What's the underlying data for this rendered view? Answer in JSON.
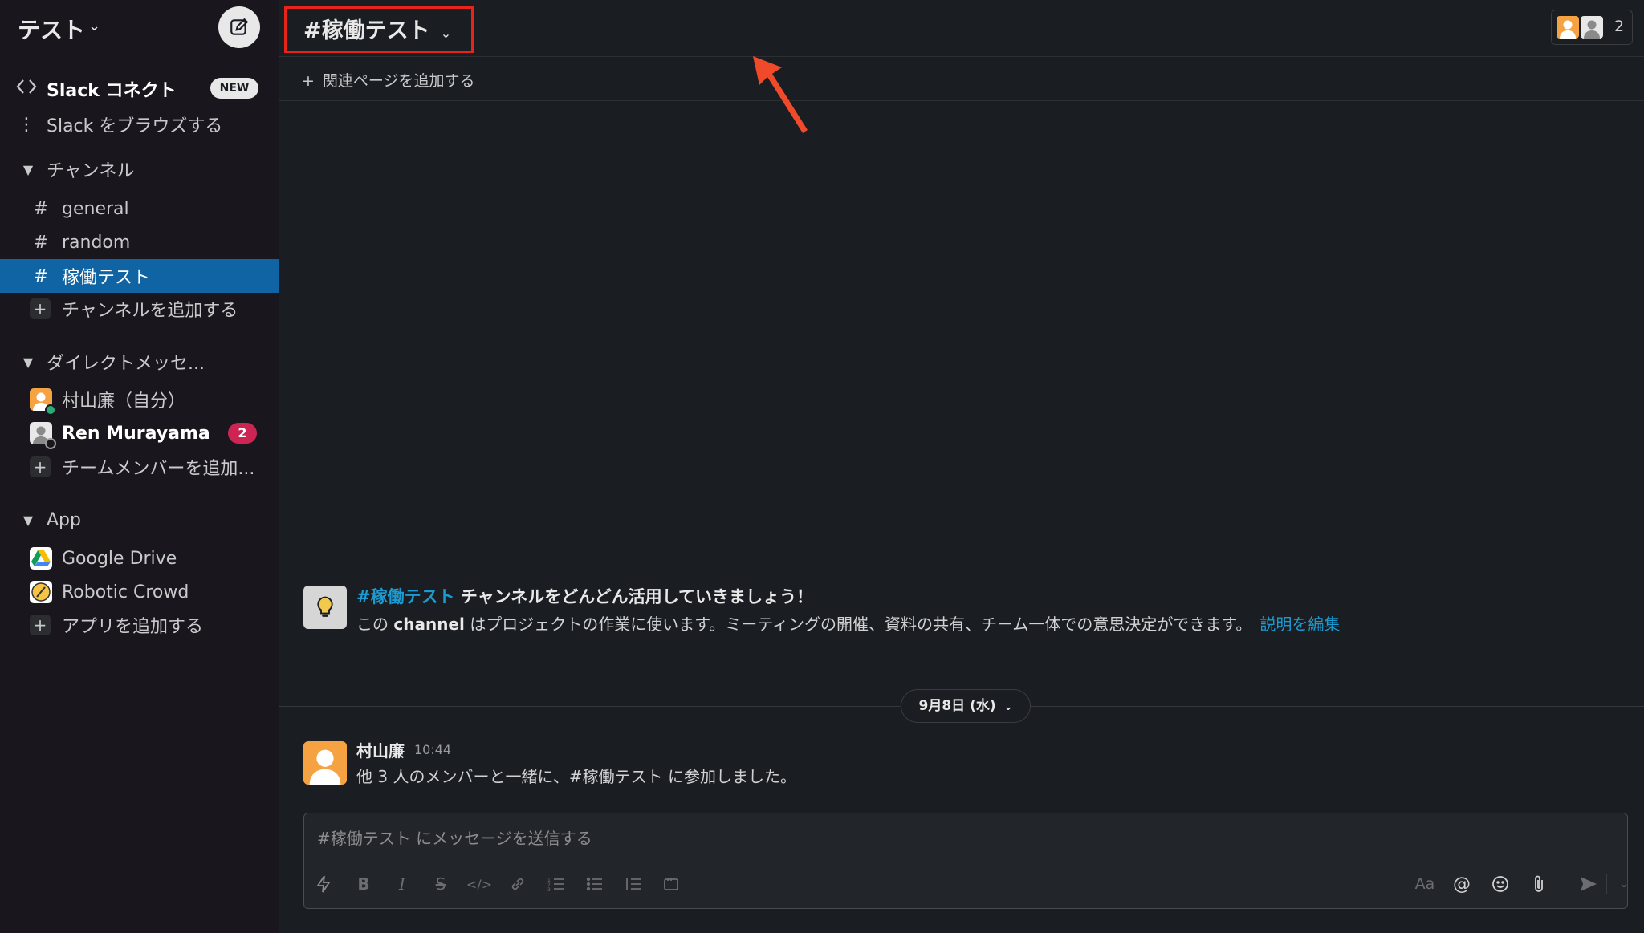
{
  "workspace": {
    "name": "テスト"
  },
  "sidebar": {
    "slack_connect": {
      "label": "Slack コネクト",
      "badge": "NEW"
    },
    "browse": {
      "label": "Slack をブラウズする"
    },
    "channels_section": "チャンネル",
    "channels": [
      {
        "hash": "#",
        "name": "general"
      },
      {
        "hash": "#",
        "name": "random"
      },
      {
        "hash": "#",
        "name": "稼働テスト"
      }
    ],
    "add_channel": "チャンネルを追加する",
    "dm_section": "ダイレクトメッセ...",
    "dms": [
      {
        "name": "村山廉（自分）"
      },
      {
        "name": "Ren Murayama",
        "badge": "2"
      }
    ],
    "add_member": "チームメンバーを追加...",
    "app_section": "App",
    "apps": [
      {
        "name": "Google Drive"
      },
      {
        "name": "Robotic Crowd"
      }
    ],
    "add_app": "アプリを追加する"
  },
  "channel": {
    "title": "#稼働テスト",
    "member_count": "2",
    "bookmark_add": "関連ページを追加する"
  },
  "intro": {
    "channel_link": "#稼働テスト",
    "title_rest": " チャンネルをどんどん活用していきましょう！",
    "desc_prefix": "この ",
    "desc_bold": "channel",
    "desc_rest": " はプロジェクトの作業に使います。ミーティングの開催、資料の共有、チーム一体での意思決定ができます。",
    "edit_link": "説明を編集"
  },
  "date_divider": "9月8日 (水)",
  "message": {
    "author": "村山廉",
    "time": "10:44",
    "text": "他 3 人のメンバーと一緒に、#稼働テスト に参加しました。"
  },
  "composer": {
    "placeholder": "#稼働テスト にメッセージを送信する",
    "format_label": "Aa"
  },
  "colors": {
    "sidebar_bg": "#19171d",
    "main_bg": "#1a1d21",
    "active_item": "#1164a3",
    "link": "#1d9bd1",
    "mention_badge": "#cd2553",
    "highlight_box": "#e8231a"
  }
}
